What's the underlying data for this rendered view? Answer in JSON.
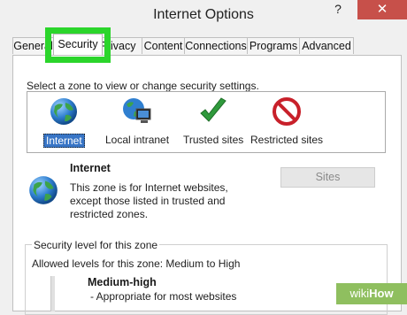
{
  "window": {
    "title": "Internet Options",
    "help_label": "?",
    "close_label": "✕"
  },
  "tabs": [
    {
      "label": "General"
    },
    {
      "label": "Security"
    },
    {
      "label": "Privacy"
    },
    {
      "label": "Content"
    },
    {
      "label": "Connections"
    },
    {
      "label": "Programs"
    },
    {
      "label": "Advanced"
    }
  ],
  "security": {
    "prompt": "Select a zone to view or change security settings.",
    "zones": [
      {
        "label": "Internet",
        "icon": "globe-icon"
      },
      {
        "label": "Local intranet",
        "icon": "globe-monitor-icon"
      },
      {
        "label": "Trusted sites",
        "icon": "checkmark-icon"
      },
      {
        "label": "Restricted sites",
        "icon": "no-entry-icon"
      }
    ],
    "selected_zone": {
      "name": "Internet",
      "description": "This zone is for Internet websites, except those listed in trusted and restricted zones."
    },
    "sites_button": "Sites",
    "level_group": {
      "legend": "Security level for this zone",
      "allowed": "Allowed levels for this zone: Medium to High",
      "level_name": "Medium-high",
      "bullet": "- Appropriate for most websites"
    }
  },
  "watermark": {
    "text_a": "wiki",
    "text_b": "How"
  },
  "colors": {
    "highlight": "#2bd52b",
    "close": "#c7504a",
    "selection": "#3875c6"
  }
}
